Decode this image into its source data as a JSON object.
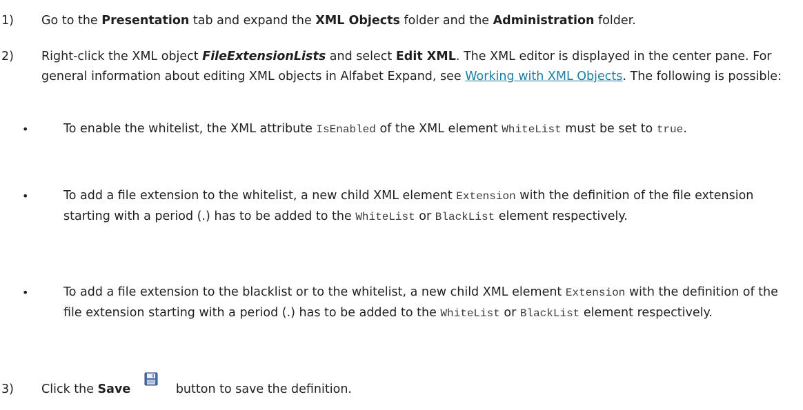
{
  "steps": [
    {
      "number": "1)",
      "t1": "Go to the ",
      "b1": "Presentation",
      "t2": " tab and expand the ",
      "b2": "XML Objects",
      "t3": " folder and the ",
      "b3": "Administration",
      "t4": " folder."
    },
    {
      "number": "2)",
      "t1": "Right-click the XML object ",
      "bi1": "FileExtensionLists",
      "t2": " and select ",
      "b1": "Edit XML",
      "t3": ". The XML editor is displayed in the center pane. For general information about editing XML objects in Alfabet Expand, see ",
      "link": "Working with XML Objects",
      "t4": ". The following is possible:"
    },
    {
      "number": "3)",
      "t1": "Click the ",
      "b1": "Save",
      "t2": " button to save the definition.",
      "icon": "save-icon"
    }
  ],
  "bullets": [
    {
      "marker": "•",
      "t1": "To enable the whitelist, the XML attribute ",
      "c1": "IsEnabled",
      "t2": " of the XML element ",
      "c2": "WhiteList",
      "t3": " must be set to ",
      "c3": "true",
      "t4": "."
    },
    {
      "marker": "•",
      "t1": "To add a file extension to the whitelist, a new child XML element ",
      "c1": "Extension",
      "t2": " with the definition of the file extension starting with a period (.) has to be added to the ",
      "c2": "WhiteList",
      "t3": " or ",
      "c3": "BlackList",
      "t4": " element respectively."
    },
    {
      "marker": "•",
      "t1": "To add a file extension to the blacklist or to the whitelist, a new child XML element ",
      "c1": "Extension",
      "t2": " with the definition of the file extension starting with a period (.) has to be added to the ",
      "c2": "WhiteList",
      "t3": " or ",
      "c3": "BlackList",
      "t4": " element respectively."
    }
  ],
  "colors": {
    "link": "#1a7fa0",
    "text": "#1f1f1f"
  }
}
